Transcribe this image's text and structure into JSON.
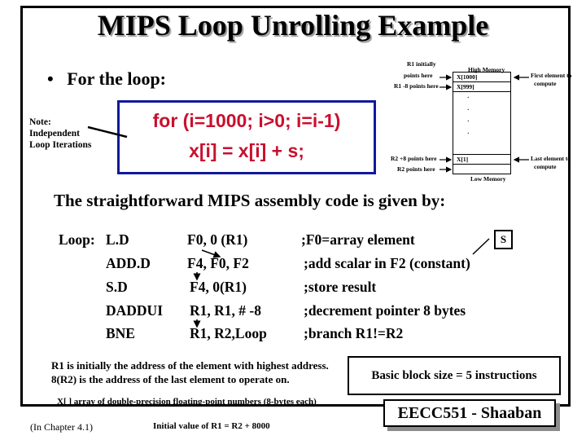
{
  "slide": {
    "title": "MIPS Loop Unrolling Example",
    "bullet": "For the loop:",
    "bullet_symbol": "•",
    "note": "Note:\nIndependent\nLoop Iterations",
    "loop_code": {
      "line1": "for (i=1000; i>0; i=i-1)",
      "line2": "x[i] = x[i] + s;"
    },
    "colors": {
      "loop_code_text": "#c8102e",
      "loop_box_border": "#10199b",
      "badge_shadow": "#8c8c8c"
    },
    "memory_diagram": {
      "high_label": "High Memory",
      "low_label": "Low Memory",
      "cells": [
        "X[1000]",
        "X[999]",
        "X[1]",
        ""
      ],
      "ellipsis": [
        "·",
        "·",
        "·",
        "·"
      ],
      "pointers": {
        "r1_initially_line1": "R1 initially",
        "r1_initially_line2": "points here",
        "r1_minus_8": "R1 -8 points here",
        "r2_plus_8": "R2 +8 points here",
        "r2": "R2 points here"
      },
      "first_element_line1": "First element to",
      "first_element_line2": "compute",
      "last_element_line1": "Last element to",
      "last_element_line2": "compute"
    },
    "heading2": "The straightforward MIPS assembly code is given by:",
    "assembly": [
      {
        "label": "Loop:",
        "op": "L.D",
        "args": "F0, 0 (R1)",
        "comment": ";F0=array element"
      },
      {
        "label": "",
        "op": "ADD.D",
        "args": "F4, F0, F2",
        "comment": ";add scalar in F2  (constant)"
      },
      {
        "label": "",
        "op": "S.D",
        "args": "F4, 0(R1)",
        "comment": ";store result"
      },
      {
        "label": "",
        "op": "DADDUI",
        "args": "R1, R1, # -8",
        "comment": ";decrement pointer 8 bytes"
      },
      {
        "label": "",
        "op": "BNE",
        "args": "R1, R2,Loop",
        "comment": ";branch R1!=R2"
      }
    ],
    "scalar_box": "S",
    "footnotes": {
      "line1": "R1 is  initially  the address of the element with highest address.",
      "line2": "8(R2)   is the address of the last element to operate on.",
      "array_note": "X[ ]   array of double-precision floating-point numbers (8-bytes each)",
      "chapter": "(In  Chapter 4.1)",
      "initial_value": "Initial value of R1 =  R2 + 8000"
    },
    "basic_block": "Basic block size  = 5  instructions",
    "badge": "EECC551 - Shaaban"
  }
}
